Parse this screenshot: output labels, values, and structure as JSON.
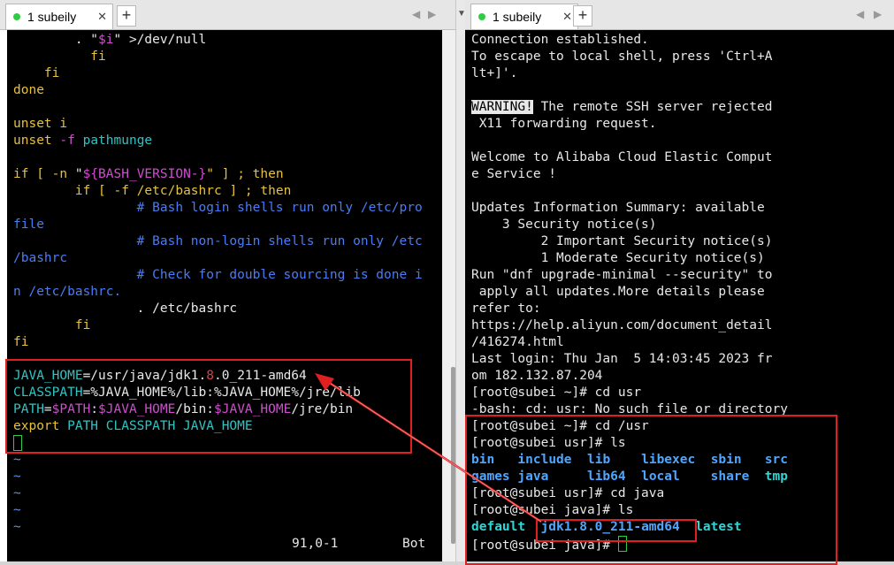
{
  "left": {
    "tab": {
      "title": "1 subeily",
      "close": "✕"
    },
    "add_tab": "+",
    "nav_prev": "◀",
    "nav_next": "▶",
    "lines": [
      [
        {
          "t": "        . \"",
          "c": ""
        },
        {
          "t": "$i",
          "c": "c-var"
        },
        {
          "t": "\" >/dev/null",
          "c": ""
        }
      ],
      [
        {
          "t": "          fi",
          "c": "c-kw"
        }
      ],
      [
        {
          "t": "    fi",
          "c": "c-kw"
        }
      ],
      [
        {
          "t": "done",
          "c": "c-kw"
        }
      ],
      [],
      [
        {
          "t": "unset i",
          "c": "c-kw"
        }
      ],
      [
        {
          "t": "unset ",
          "c": "c-kw"
        },
        {
          "t": "-f ",
          "c": "c-var"
        },
        {
          "t": "pathmunge",
          "c": "c-cyan"
        }
      ],
      [],
      [
        {
          "t": "if [ ",
          "c": "c-kw"
        },
        {
          "t": "-n",
          "c": "c-kw"
        },
        {
          "t": " \"",
          "c": ""
        },
        {
          "t": "${BASH_VERSION-}",
          "c": "c-var"
        },
        {
          "t": "\" ] ; then",
          "c": "c-kw"
        }
      ],
      [
        {
          "t": "        if [ ",
          "c": "c-kw"
        },
        {
          "t": "-f",
          "c": "c-kw"
        },
        {
          "t": " /etc/bashrc ] ; then",
          "c": "c-kw"
        }
      ],
      [
        {
          "t": "                # Bash login shells run only /etc/pro",
          "c": "c-cmt"
        }
      ],
      [
        {
          "t": "file",
          "c": "c-cmt"
        }
      ],
      [
        {
          "t": "                # Bash non-login shells run only /etc",
          "c": "c-cmt"
        }
      ],
      [
        {
          "t": "/bashrc",
          "c": "c-cmt"
        }
      ],
      [
        {
          "t": "                # Check for double sourcing is done i",
          "c": "c-cmt"
        }
      ],
      [
        {
          "t": "n /etc/bashrc.",
          "c": "c-cmt"
        }
      ],
      [
        {
          "t": "                . /etc/bashrc",
          "c": ""
        }
      ],
      [
        {
          "t": "        fi",
          "c": "c-kw"
        }
      ],
      [
        {
          "t": "fi",
          "c": "c-kw"
        }
      ],
      [],
      [
        {
          "t": "JAVA_HOME",
          "c": "c-cyan"
        },
        {
          "t": "=/usr/java/jdk1.",
          "c": ""
        },
        {
          "t": "8",
          "c": "c-num"
        },
        {
          "t": ".0_211-amd64",
          "c": ""
        }
      ],
      [
        {
          "t": "CLASSPATH",
          "c": "c-cyan"
        },
        {
          "t": "=%JAVA_HOME%/lib:%JAVA_HOME%/jre/lib",
          "c": ""
        }
      ],
      [
        {
          "t": "PATH",
          "c": "c-cyan"
        },
        {
          "t": "=",
          "c": ""
        },
        {
          "t": "$PATH",
          "c": "c-var"
        },
        {
          "t": ":",
          "c": ""
        },
        {
          "t": "$JAVA_HOME",
          "c": "c-var"
        },
        {
          "t": "/bin:",
          "c": ""
        },
        {
          "t": "$JAVA_HOME",
          "c": "c-var"
        },
        {
          "t": "/jre/bin",
          "c": ""
        }
      ],
      [
        {
          "t": "export ",
          "c": "c-kw"
        },
        {
          "t": "PATH CLASSPATH JAVA_HOME",
          "c": "c-cyan"
        }
      ],
      [
        {
          "cursor": true
        }
      ],
      [
        {
          "t": "~",
          "c": "c-tilde"
        }
      ],
      [
        {
          "t": "~",
          "c": "c-tilde"
        }
      ],
      [
        {
          "t": "~",
          "c": "c-tilde"
        }
      ],
      [
        {
          "t": "~",
          "c": "c-tilde"
        }
      ],
      [
        {
          "t": "~",
          "c": "c-tilde"
        }
      ]
    ],
    "status_pos": "91,0-1",
    "status_bot": "Bot"
  },
  "right": {
    "tab": {
      "title": "1 subeily",
      "close": "✕"
    },
    "add_tab": "+",
    "nav_prev": "◀",
    "nav_next": "▶",
    "lines": [
      [
        {
          "t": "Connection established.",
          "c": ""
        }
      ],
      [
        {
          "t": "To escape to local shell, press 'Ctrl+A",
          "c": ""
        }
      ],
      [
        {
          "t": "lt+]'.",
          "c": ""
        }
      ],
      [],
      [
        {
          "t": "WARNING!",
          "c": "warn"
        },
        {
          "t": " The remote SSH server rejected",
          "c": ""
        }
      ],
      [
        {
          "t": " X11 forwarding request.",
          "c": ""
        }
      ],
      [],
      [
        {
          "t": "Welcome to Alibaba Cloud Elastic Comput",
          "c": ""
        }
      ],
      [
        {
          "t": "e Service !",
          "c": ""
        }
      ],
      [],
      [
        {
          "t": "Updates Information Summary: available",
          "c": ""
        }
      ],
      [
        {
          "t": "    3 Security notice(s)",
          "c": ""
        }
      ],
      [
        {
          "t": "         2 Important Security notice(s)",
          "c": ""
        }
      ],
      [
        {
          "t": "         1 Moderate Security notice(s)",
          "c": ""
        }
      ],
      [
        {
          "t": "Run \"dnf upgrade-minimal --security\" to",
          "c": ""
        }
      ],
      [
        {
          "t": " apply all updates.More details please",
          "c": ""
        }
      ],
      [
        {
          "t": "refer to:",
          "c": ""
        }
      ],
      [
        {
          "t": "https://help.aliyun.com/document_detail",
          "c": ""
        }
      ],
      [
        {
          "t": "/416274.html",
          "c": ""
        }
      ],
      [
        {
          "t": "Last login: Thu Jan  5 14:03:45 2023 fr",
          "c": ""
        }
      ],
      [
        {
          "t": "om 182.132.87.204",
          "c": ""
        }
      ],
      [
        {
          "t": "[root@subei ~]# cd usr",
          "c": ""
        }
      ],
      [
        {
          "t": "-bash: cd: usr: No such file or directory",
          "c": ""
        }
      ],
      [
        {
          "t": "[root@subei ~]# cd /usr",
          "c": ""
        }
      ],
      [
        {
          "t": "[root@subei usr]# ls",
          "c": ""
        }
      ],
      [
        {
          "t": "bin",
          "c": "c-bold-blue"
        },
        {
          "t": "   ",
          "c": ""
        },
        {
          "t": "include",
          "c": "c-bold-blue"
        },
        {
          "t": "  ",
          "c": ""
        },
        {
          "t": "lib",
          "c": "c-bold-blue"
        },
        {
          "t": "    ",
          "c": ""
        },
        {
          "t": "libexec",
          "c": "c-bold-blue"
        },
        {
          "t": "  ",
          "c": ""
        },
        {
          "t": "sbin",
          "c": "c-bold-blue"
        },
        {
          "t": "   ",
          "c": ""
        },
        {
          "t": "src",
          "c": "c-bold-blue"
        }
      ],
      [
        {
          "t": "games",
          "c": "c-bold-blue"
        },
        {
          "t": " ",
          "c": ""
        },
        {
          "t": "java",
          "c": "c-bold-blue"
        },
        {
          "t": "     ",
          "c": ""
        },
        {
          "t": "lib64",
          "c": "c-bold-blue"
        },
        {
          "t": "  ",
          "c": ""
        },
        {
          "t": "local",
          "c": "c-bold-blue"
        },
        {
          "t": "    ",
          "c": ""
        },
        {
          "t": "share",
          "c": "c-bold-blue"
        },
        {
          "t": "  ",
          "c": ""
        },
        {
          "t": "tmp",
          "c": "c-bold-cyan"
        }
      ],
      [
        {
          "t": "[root@subei usr]# cd java",
          "c": ""
        }
      ],
      [
        {
          "t": "[root@subei java]# ls",
          "c": ""
        }
      ],
      [
        {
          "t": "default",
          "c": "c-bold-cyan"
        },
        {
          "t": "  ",
          "c": ""
        },
        {
          "t": "jdk1.8.0_211-amd64",
          "c": "c-bold-blue"
        },
        {
          "t": "  ",
          "c": ""
        },
        {
          "t": "latest",
          "c": "c-bold-cyan"
        }
      ],
      [
        {
          "t": "[root@subei java]# ",
          "c": ""
        },
        {
          "cursor": true
        }
      ]
    ]
  }
}
